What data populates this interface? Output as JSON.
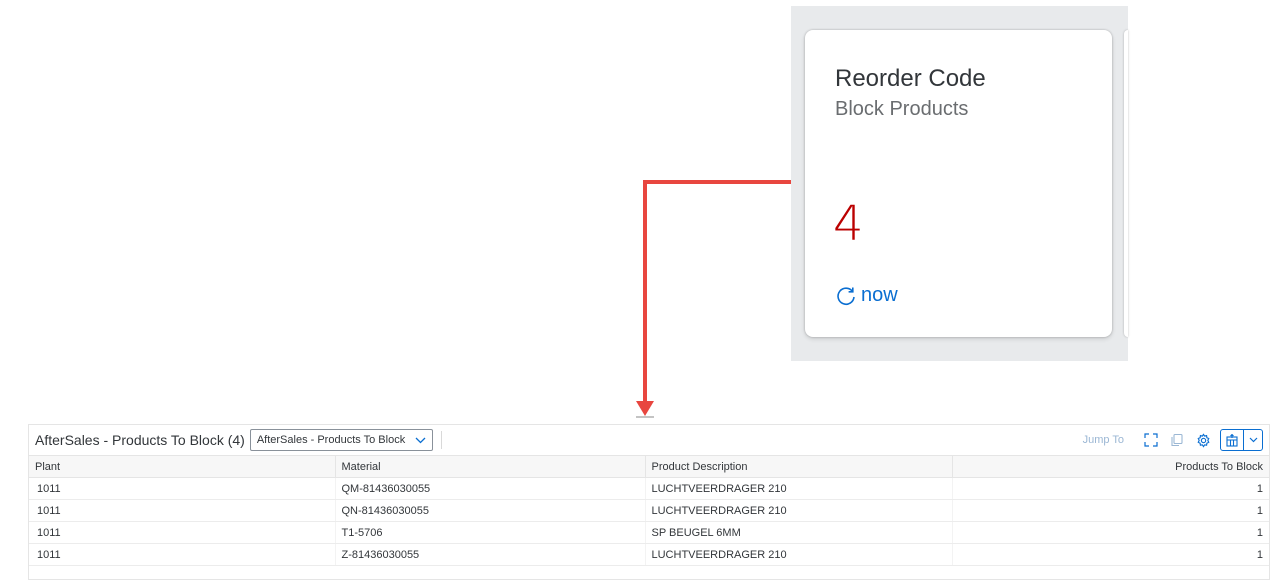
{
  "tile": {
    "title": "Reorder Code",
    "subtitle": "Block Products",
    "kpi_value": "4",
    "refresh_label": "now",
    "kpi_color": "#bb0000",
    "refresh_icon": "refresh-icon"
  },
  "annotation": {
    "arrow_color": "#e8463f"
  },
  "table": {
    "title": "AfterSales - Products To Block (4)",
    "variant": "AfterSales - Products To Block",
    "jump_to": "Jump To",
    "columns": [
      "Plant",
      "Material",
      "Product Description",
      "Products To Block"
    ],
    "rows": [
      [
        "1011",
        "QM-81436030055",
        "LUCHTVEERDRAGER 210",
        "1"
      ],
      [
        "1011",
        "QN-81436030055",
        "LUCHTVEERDRAGER 210",
        "1"
      ],
      [
        "1011",
        "T1-5706",
        "SP BEUGEL 6MM",
        "1"
      ],
      [
        "1011",
        "Z-81436030055",
        "LUCHTVEERDRAGER 210",
        "1"
      ]
    ],
    "accent": "#0a6ed1",
    "icons": [
      "fullscreen-icon",
      "copy-icon",
      "settings-icon",
      "export-icon",
      "chevron-down-icon"
    ]
  }
}
